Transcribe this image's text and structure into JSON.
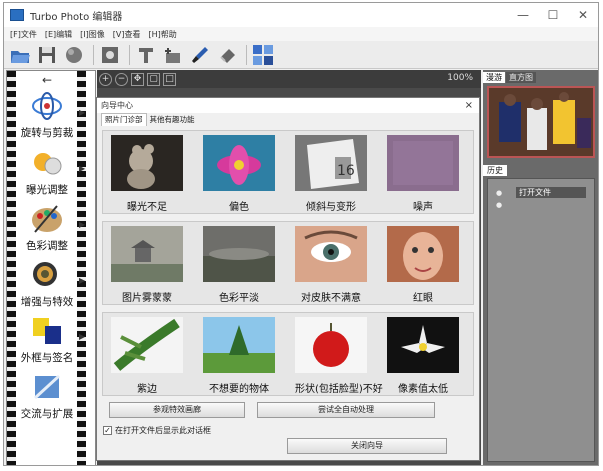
{
  "window": {
    "title": "Turbo Photo 编辑器",
    "controls": [
      "—",
      "☐",
      "✕"
    ]
  },
  "menu": [
    "[F]文件",
    "[E]编辑",
    "[I]图像",
    "[V]查看",
    "[H]帮助"
  ],
  "toolbar_icons": [
    "open-icon",
    "save-icon",
    "sphere-icon",
    "capture-icon",
    "text-icon",
    "add-text-icon",
    "brush-icon",
    "eraser-icon",
    "batch-icon"
  ],
  "sidebar": {
    "items": [
      {
        "label": "旋转与剪裁",
        "icon": "rotate-crop-icon"
      },
      {
        "label": "曝光调整",
        "icon": "exposure-icon"
      },
      {
        "label": "色彩调整",
        "icon": "palette-icon"
      },
      {
        "label": "增强与特效",
        "icon": "enhance-icon"
      },
      {
        "label": "外框与签名",
        "icon": "frame-icon"
      },
      {
        "label": "交流与扩展",
        "icon": "share-icon"
      }
    ]
  },
  "canvas": {
    "zoom": "100%"
  },
  "dialog": {
    "title": "向导中心",
    "close": "×",
    "tabs": [
      "照片门诊部",
      "其他有趣功能"
    ],
    "row1": [
      "曝光不足",
      "偏色",
      "倾斜与变形",
      "噪声"
    ],
    "row2": [
      "图片雾蒙蒙",
      "色彩平淡",
      "对皮肤不满意",
      "红眼"
    ],
    "row3": [
      "紫边",
      "不想要的物体",
      "形状(包括脸型)不好",
      "像素值太低"
    ],
    "btn_effects": "参观特效画廊",
    "btn_auto": "尝试全自动处理",
    "checkbox": "在打开文件后显示此对话框",
    "btn_close": "关闭向导"
  },
  "right": {
    "tabs": [
      "漫游",
      "直方图"
    ],
    "history_tab": "历史",
    "history_items": [
      "打开文件"
    ]
  }
}
